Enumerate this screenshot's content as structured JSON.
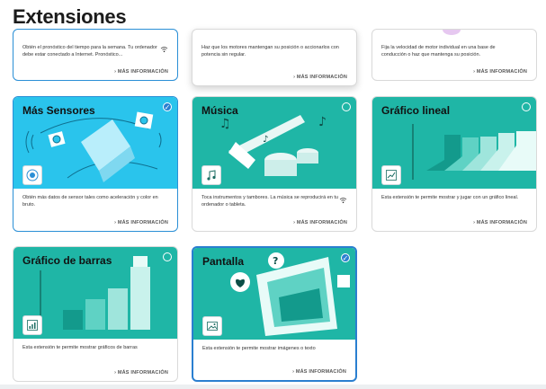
{
  "page_title": "Extensiones",
  "more_label": "› MÁS INFORMACIÓN",
  "top_cards": [
    {
      "desc": "Obtén el pronóstico del tiempo para la semana. Tu ordenador debe estar conectado a Internet. Pronóstico..."
    },
    {
      "desc": "Haz que los motores mantengan su posición o accionarlos con potencia sin regular."
    },
    {
      "desc": "Fija la velocidad de motor individual en una base de conducción o haz que mantenga su posición."
    }
  ],
  "cards": [
    {
      "name": "Más Sensores",
      "selected": true,
      "color": "#2ac4ec",
      "icon": "sensor-icon",
      "desc": "Obtén más datos de sensor tales como aceleración y color en bruto."
    },
    {
      "name": "Música",
      "selected": false,
      "color": "#1fb6a6",
      "icon": "music-icon",
      "desc": "Toca instrumentos y tambores. La música se reproducirá en tu ordenador o tableta."
    },
    {
      "name": "Gráfico lineal",
      "selected": false,
      "color": "#1fb6a6",
      "icon": "line-chart-icon",
      "desc": "Esta extensión te permite mostrar y jugar con un gráfico lineal."
    },
    {
      "name": "Gráfico de barras",
      "selected": false,
      "color": "#1fb6a6",
      "icon": "bar-chart-icon",
      "desc": "Esta extensión te permite mostrar gráficos de barras"
    },
    {
      "name": "Pantalla",
      "selected": true,
      "color": "#1fb6a6",
      "icon": "image-icon",
      "desc": "Esta extensión te permite mostrar imágenes o texto"
    }
  ]
}
